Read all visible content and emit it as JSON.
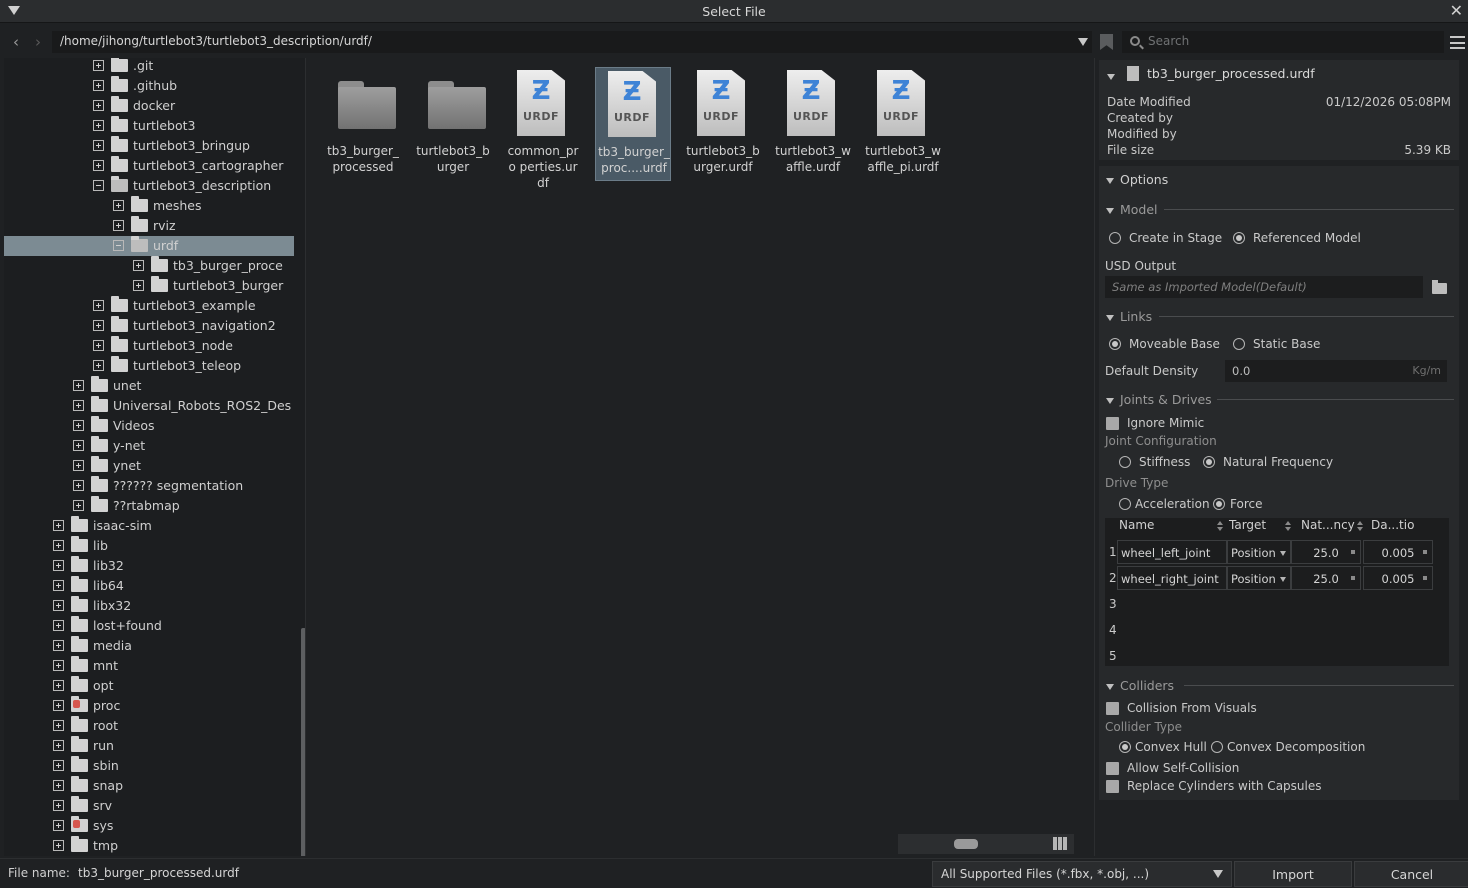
{
  "window": {
    "title": "Select File"
  },
  "path": {
    "value": "/home/jihong/turtlebot3/turtlebot3_description/urdf/"
  },
  "search": {
    "placeholder": "Search"
  },
  "tree": [
    {
      "label": ".git",
      "depth": 3,
      "expanded": false,
      "open": false
    },
    {
      "label": ".github",
      "depth": 3,
      "expanded": false,
      "open": false
    },
    {
      "label": "docker",
      "depth": 3,
      "expanded": false,
      "open": false
    },
    {
      "label": "turtlebot3",
      "depth": 3,
      "expanded": false,
      "open": false
    },
    {
      "label": "turtlebot3_bringup",
      "depth": 3,
      "expanded": false,
      "open": false
    },
    {
      "label": "turtlebot3_cartographer",
      "depth": 3,
      "expanded": false,
      "open": false
    },
    {
      "label": "turtlebot3_description",
      "depth": 3,
      "expanded": true,
      "open": true
    },
    {
      "label": "meshes",
      "depth": 4,
      "expanded": false,
      "open": false
    },
    {
      "label": "rviz",
      "depth": 4,
      "expanded": false,
      "open": false
    },
    {
      "label": "urdf",
      "depth": 4,
      "expanded": true,
      "open": true,
      "selected": true
    },
    {
      "label": "tb3_burger_proce",
      "depth": 5,
      "expanded": false,
      "open": false
    },
    {
      "label": "turtlebot3_burger",
      "depth": 5,
      "expanded": false,
      "open": false
    },
    {
      "label": "turtlebot3_example",
      "depth": 3,
      "expanded": false,
      "open": false
    },
    {
      "label": "turtlebot3_navigation2",
      "depth": 3,
      "expanded": false,
      "open": false
    },
    {
      "label": "turtlebot3_node",
      "depth": 3,
      "expanded": false,
      "open": false
    },
    {
      "label": "turtlebot3_teleop",
      "depth": 3,
      "expanded": false,
      "open": false
    },
    {
      "label": "unet",
      "depth": 2,
      "expanded": false,
      "open": false
    },
    {
      "label": "Universal_Robots_ROS2_Des",
      "depth": 2,
      "expanded": false,
      "open": false
    },
    {
      "label": "Videos",
      "depth": 2,
      "expanded": false,
      "open": false
    },
    {
      "label": "y-net",
      "depth": 2,
      "expanded": false,
      "open": false
    },
    {
      "label": "ynet",
      "depth": 2,
      "expanded": false,
      "open": false
    },
    {
      "label": "?????? segmentation",
      "depth": 2,
      "expanded": false,
      "open": false
    },
    {
      "label": "??rtabmap",
      "depth": 2,
      "expanded": false,
      "open": false
    },
    {
      "label": "isaac-sim",
      "depth": 1,
      "expanded": false,
      "open": false
    },
    {
      "label": "lib",
      "depth": 1,
      "expanded": false,
      "open": false
    },
    {
      "label": "lib32",
      "depth": 1,
      "expanded": false,
      "open": false
    },
    {
      "label": "lib64",
      "depth": 1,
      "expanded": false,
      "open": false
    },
    {
      "label": "libx32",
      "depth": 1,
      "expanded": false,
      "open": false
    },
    {
      "label": "lost+found",
      "depth": 1,
      "expanded": false,
      "open": false
    },
    {
      "label": "media",
      "depth": 1,
      "expanded": false,
      "open": false
    },
    {
      "label": "mnt",
      "depth": 1,
      "expanded": false,
      "open": false
    },
    {
      "label": "opt",
      "depth": 1,
      "expanded": false,
      "open": false
    },
    {
      "label": "proc",
      "depth": 1,
      "expanded": false,
      "open": false,
      "locked": true
    },
    {
      "label": "root",
      "depth": 1,
      "expanded": false,
      "open": false
    },
    {
      "label": "run",
      "depth": 1,
      "expanded": false,
      "open": false
    },
    {
      "label": "sbin",
      "depth": 1,
      "expanded": false,
      "open": false
    },
    {
      "label": "snap",
      "depth": 1,
      "expanded": false,
      "open": false
    },
    {
      "label": "srv",
      "depth": 1,
      "expanded": false,
      "open": false
    },
    {
      "label": "sys",
      "depth": 1,
      "expanded": false,
      "open": false,
      "locked": true
    },
    {
      "label": "tmp",
      "depth": 1,
      "expanded": false,
      "open": false
    }
  ],
  "files": [
    {
      "label": "tb3_burger_ processed",
      "kind": "folder"
    },
    {
      "label": "turtlebot3_b urger",
      "kind": "folder"
    },
    {
      "label": "common_pro perties.urdf",
      "kind": "urdf"
    },
    {
      "label": "tb3_burger_ proc....urdf",
      "kind": "urdf",
      "selected": true
    },
    {
      "label": "turtlebot3_b urger.urdf",
      "kind": "urdf"
    },
    {
      "label": "turtlebot3_w affle.urdf",
      "kind": "urdf"
    },
    {
      "label": "turtlebot3_w affle_pi.urdf",
      "kind": "urdf"
    }
  ],
  "urdf_badge": "URDF",
  "details": {
    "filename": "tb3_burger_processed.urdf",
    "date_modified_label": "Date Modified",
    "date_modified": "01/12/2026 05:08PM",
    "created_by_label": "Created by",
    "modified_by_label": "Modified by",
    "file_size_label": "File size",
    "file_size": "5.39 KB"
  },
  "options": {
    "title": "Options",
    "model": {
      "title": "Model",
      "create_in_stage": "Create in Stage",
      "referenced_model": "Referenced Model",
      "usd_output_label": "USD Output",
      "usd_output_placeholder": "Same as Imported Model(Default)"
    },
    "links": {
      "title": "Links",
      "moveable_base": "Moveable Base",
      "static_base": "Static Base",
      "default_density_label": "Default Density",
      "default_density_value": "0.0",
      "density_unit": "Kg/m"
    },
    "joints": {
      "title": "Joints & Drives",
      "ignore_mimic": "Ignore Mimic",
      "joint_config_label": "Joint Configuration",
      "stiffness": "Stiffness",
      "natural_frequency": "Natural Frequency",
      "drive_type_label": "Drive Type",
      "acceleration": "Acceleration",
      "force": "Force",
      "columns": [
        "Name",
        "Target",
        "Nat...ncy",
        "Da...tio"
      ],
      "rows": [
        {
          "num": "1",
          "name": "wheel_left_joint",
          "target": "Position",
          "freq": "25.0",
          "damp": "0.005"
        },
        {
          "num": "2",
          "name": "wheel_right_joint",
          "target": "Position",
          "freq": "25.0",
          "damp": "0.005"
        },
        {
          "num": "3"
        },
        {
          "num": "4"
        },
        {
          "num": "5"
        }
      ]
    },
    "colliders": {
      "title": "Colliders",
      "collision_from_visuals": "Collision From Visuals",
      "collider_type_label": "Collider Type",
      "convex_hull": "Convex Hull",
      "convex_decomposition": "Convex Decomposition",
      "allow_self_collision": "Allow Self-Collision",
      "replace_cylinders": "Replace Cylinders with Capsules"
    }
  },
  "bottom": {
    "file_name_label": "File name:",
    "file_name_value": "tb3_burger_processed.urdf",
    "filter": "All Supported Files (*.fbx, *.obj, ...)",
    "import_label": "Import",
    "cancel_label": "Cancel"
  }
}
